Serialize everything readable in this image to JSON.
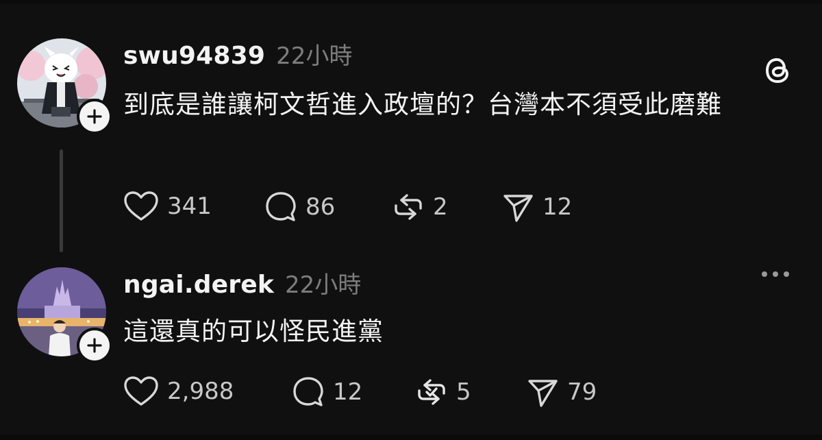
{
  "posts": [
    {
      "username": "swu94839",
      "time": "22小時",
      "text": "到底是誰讓柯文哲進入政壇的？台灣本不須受此磨難",
      "likes": "341",
      "replies": "86",
      "reposts": "2",
      "shares": "12",
      "header_icon": "threads-logo-icon"
    },
    {
      "username": "ngai.derek",
      "time": "22小時",
      "text": "這還真的可以怪民進黨",
      "likes": "2,988",
      "replies": "12",
      "reposts": "5",
      "shares": "79",
      "header_icon": "more-options-icon",
      "reposted_by_viewer": true
    }
  ],
  "colors": {
    "background": "#101010",
    "primary_text": "#f3f3f3",
    "secondary_text": "#7d7d7d",
    "count_text": "#c8c8c8",
    "thread_line": "#3a3a3a"
  }
}
